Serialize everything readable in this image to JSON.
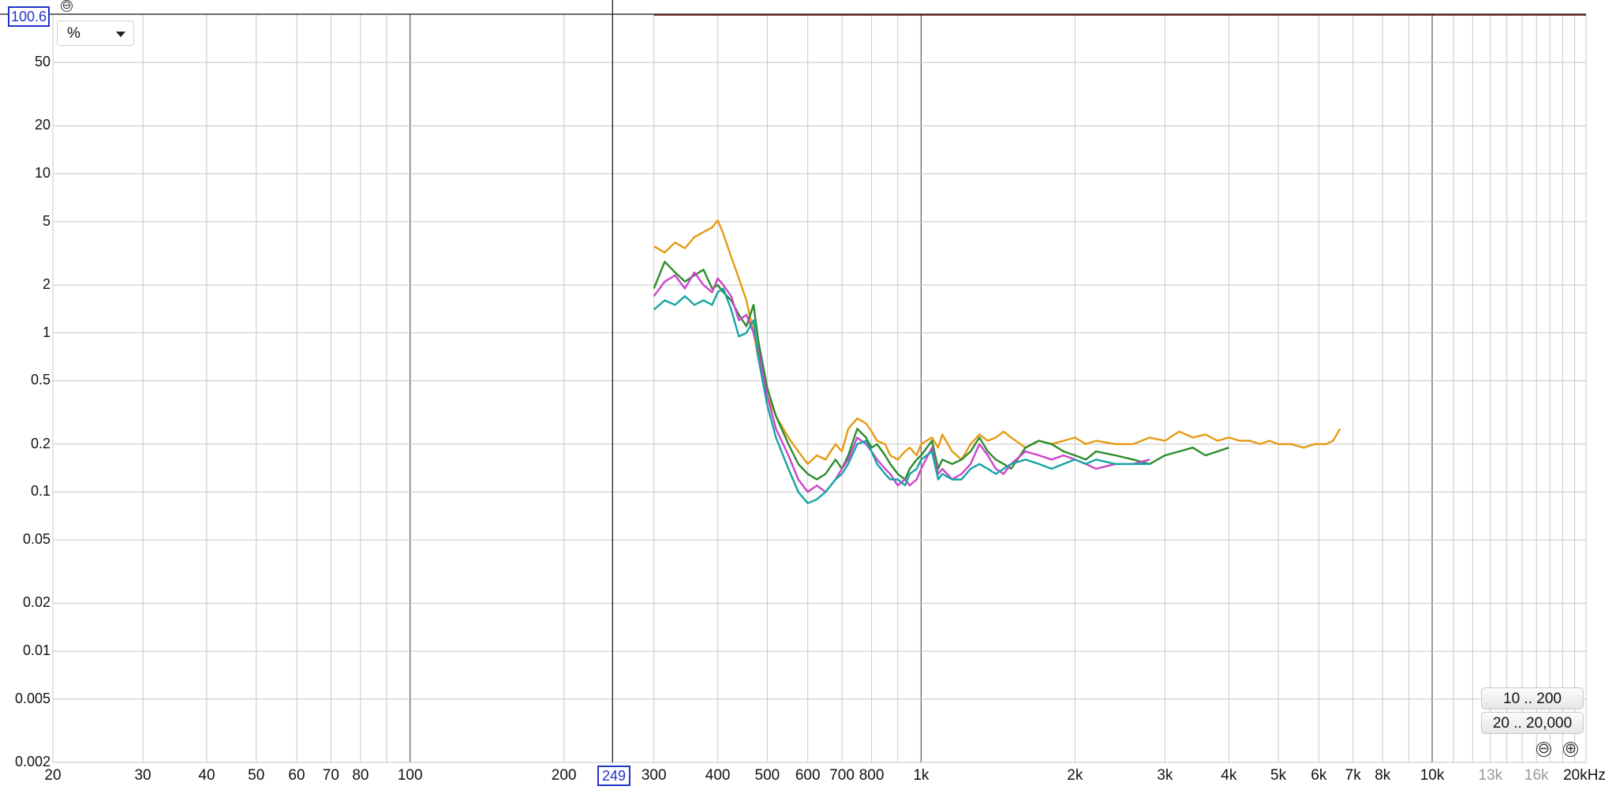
{
  "controls": {
    "unit": "%",
    "y_cursor": "100.6",
    "x_cursor": "249",
    "range_buttons": [
      "10 .. 200",
      "20 .. 20,000"
    ],
    "zoom_out_symbol": "⊖",
    "zoom_in_symbol": "⊕"
  },
  "chart_data": {
    "type": "line",
    "title": "",
    "xlabel": "",
    "ylabel": "",
    "x_scale": "log",
    "y_scale": "log",
    "xlim": [
      20,
      20000
    ],
    "ylim": [
      0.002,
      100.6
    ],
    "grid": true,
    "y_ticks": [
      "50",
      "20",
      "10",
      "5",
      "2",
      "1",
      "0.5",
      "0.2",
      "0.1",
      "0.05",
      "0.02",
      "0.01",
      "0.005",
      "0.002"
    ],
    "y_tick_values": [
      50,
      20,
      10,
      5,
      2,
      1,
      0.5,
      0.2,
      0.1,
      0.05,
      0.02,
      0.01,
      0.005,
      0.002
    ],
    "x_ticks": [
      "20",
      "30",
      "40",
      "50",
      "60",
      "70",
      "80",
      "100",
      "200",
      "300",
      "400",
      "500",
      "600",
      "700",
      "800",
      "1k",
      "2k",
      "3k",
      "4k",
      "5k",
      "6k",
      "7k",
      "8k",
      "10k",
      "13k",
      "16k",
      "20kHz"
    ],
    "x_tick_values": [
      20,
      30,
      40,
      50,
      60,
      70,
      80,
      100,
      200,
      300,
      400,
      500,
      600,
      700,
      800,
      1000,
      2000,
      3000,
      4000,
      5000,
      6000,
      7000,
      8000,
      10000,
      13000,
      16000,
      20000
    ],
    "x_tick_dim": [
      false,
      false,
      false,
      false,
      false,
      false,
      false,
      false,
      false,
      false,
      false,
      false,
      false,
      false,
      false,
      false,
      false,
      false,
      false,
      false,
      false,
      false,
      false,
      false,
      true,
      true,
      false
    ],
    "cursor_x": 249,
    "cursor_y": 100.6,
    "series": [
      {
        "color": "#e69a12",
        "x": [
          300,
          315,
          330,
          345,
          360,
          375,
          390,
          400,
          410,
          425,
          440,
          455,
          470,
          480,
          500,
          520,
          550,
          575,
          600,
          625,
          650,
          680,
          700,
          720,
          750,
          780,
          800,
          820,
          850,
          870,
          900,
          930,
          950,
          980,
          1000,
          1050,
          1080,
          1100,
          1150,
          1200,
          1250,
          1300,
          1350,
          1400,
          1450,
          1500,
          1600,
          1700,
          1800,
          1900,
          2000,
          2100,
          2200,
          2400,
          2600,
          2800,
          3000,
          3200,
          3400,
          3600,
          3800,
          4000,
          4200,
          4400,
          4600,
          4800,
          5000,
          5300,
          5600,
          5900,
          6200,
          6400,
          6600
        ],
        "y": [
          3.5,
          3.2,
          3.7,
          3.4,
          4.0,
          4.3,
          4.6,
          5.1,
          4.2,
          3.0,
          2.2,
          1.6,
          1.0,
          0.7,
          0.4,
          0.3,
          0.22,
          0.18,
          0.15,
          0.17,
          0.16,
          0.2,
          0.18,
          0.25,
          0.29,
          0.27,
          0.24,
          0.21,
          0.2,
          0.17,
          0.16,
          0.18,
          0.19,
          0.17,
          0.2,
          0.22,
          0.19,
          0.23,
          0.18,
          0.16,
          0.2,
          0.23,
          0.21,
          0.22,
          0.24,
          0.22,
          0.19,
          0.21,
          0.2,
          0.21,
          0.22,
          0.2,
          0.21,
          0.2,
          0.2,
          0.22,
          0.21,
          0.24,
          0.22,
          0.23,
          0.21,
          0.22,
          0.21,
          0.21,
          0.2,
          0.21,
          0.2,
          0.2,
          0.19,
          0.2,
          0.2,
          0.21,
          0.25
        ]
      },
      {
        "color": "#2a8c2a",
        "x": [
          300,
          315,
          330,
          345,
          360,
          375,
          390,
          400,
          410,
          425,
          440,
          455,
          470,
          480,
          500,
          520,
          550,
          575,
          600,
          625,
          650,
          680,
          700,
          720,
          750,
          780,
          800,
          820,
          850,
          870,
          900,
          930,
          950,
          980,
          1000,
          1050,
          1080,
          1100,
          1150,
          1200,
          1250,
          1300,
          1350,
          1400,
          1450,
          1500,
          1600,
          1700,
          1800,
          1900,
          2000,
          2100,
          2200,
          2400,
          2600,
          2800,
          3000,
          3200,
          3400,
          3600,
          3800,
          4000
        ],
        "y": [
          1.9,
          2.8,
          2.4,
          2.1,
          2.3,
          2.5,
          1.9,
          2.0,
          1.8,
          1.6,
          1.3,
          1.1,
          1.5,
          0.9,
          0.45,
          0.3,
          0.2,
          0.15,
          0.13,
          0.12,
          0.13,
          0.16,
          0.14,
          0.17,
          0.25,
          0.22,
          0.19,
          0.2,
          0.17,
          0.15,
          0.13,
          0.12,
          0.14,
          0.16,
          0.17,
          0.21,
          0.14,
          0.16,
          0.15,
          0.16,
          0.18,
          0.22,
          0.18,
          0.16,
          0.15,
          0.14,
          0.19,
          0.21,
          0.2,
          0.18,
          0.17,
          0.16,
          0.18,
          0.17,
          0.16,
          0.15,
          0.17,
          0.18,
          0.19,
          0.17,
          0.18,
          0.19
        ]
      },
      {
        "color": "#cc44cc",
        "x": [
          300,
          315,
          330,
          345,
          360,
          375,
          390,
          400,
          410,
          425,
          440,
          455,
          470,
          480,
          500,
          520,
          550,
          575,
          600,
          625,
          650,
          680,
          700,
          720,
          750,
          780,
          800,
          820,
          850,
          870,
          900,
          930,
          950,
          980,
          1000,
          1050,
          1080,
          1100,
          1150,
          1200,
          1250,
          1300,
          1350,
          1400,
          1450,
          1500,
          1600,
          1700,
          1800,
          1900,
          2000,
          2100,
          2200,
          2400,
          2600,
          2800
        ],
        "y": [
          1.7,
          2.1,
          2.3,
          1.9,
          2.4,
          2.0,
          1.8,
          2.2,
          2.0,
          1.7,
          1.2,
          1.3,
          1.0,
          0.8,
          0.4,
          0.25,
          0.17,
          0.12,
          0.1,
          0.11,
          0.1,
          0.12,
          0.14,
          0.16,
          0.22,
          0.2,
          0.18,
          0.16,
          0.14,
          0.13,
          0.11,
          0.12,
          0.11,
          0.12,
          0.14,
          0.19,
          0.13,
          0.14,
          0.12,
          0.13,
          0.15,
          0.2,
          0.17,
          0.14,
          0.13,
          0.15,
          0.18,
          0.17,
          0.16,
          0.17,
          0.16,
          0.15,
          0.14,
          0.15,
          0.15,
          0.16
        ]
      },
      {
        "color": "#16a4a4",
        "x": [
          300,
          315,
          330,
          345,
          360,
          375,
          390,
          400,
          410,
          425,
          440,
          455,
          470,
          480,
          500,
          520,
          550,
          575,
          600,
          625,
          650,
          680,
          700,
          720,
          750,
          780,
          800,
          820,
          850,
          870,
          900,
          930,
          950,
          980,
          1000,
          1050,
          1080,
          1100,
          1150,
          1200,
          1250,
          1300,
          1350,
          1400,
          1450,
          1500,
          1600,
          1700,
          1800,
          1900,
          2000,
          2100,
          2200,
          2400,
          2600,
          2800
        ],
        "y": [
          1.4,
          1.6,
          1.5,
          1.7,
          1.5,
          1.6,
          1.5,
          1.8,
          1.9,
          1.4,
          0.95,
          1.0,
          1.2,
          0.7,
          0.35,
          0.22,
          0.14,
          0.1,
          0.085,
          0.09,
          0.1,
          0.12,
          0.13,
          0.15,
          0.2,
          0.21,
          0.18,
          0.15,
          0.13,
          0.12,
          0.12,
          0.11,
          0.13,
          0.14,
          0.16,
          0.18,
          0.12,
          0.13,
          0.12,
          0.12,
          0.14,
          0.15,
          0.14,
          0.13,
          0.14,
          0.15,
          0.16,
          0.15,
          0.14,
          0.15,
          0.16,
          0.15,
          0.16,
          0.15,
          0.15,
          0.15
        ]
      }
    ]
  }
}
